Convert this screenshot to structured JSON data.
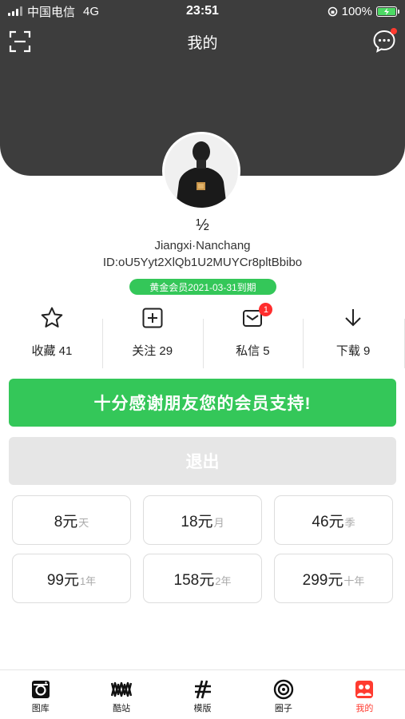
{
  "status_bar": {
    "carrier": "中国电信",
    "network": "4G",
    "time": "23:51",
    "battery": "100%"
  },
  "nav": {
    "title": "我的",
    "left_icon": "scan-icon",
    "right_icon": "message-icon"
  },
  "profile": {
    "username": "½",
    "location": "Jiangxi·Nanchang",
    "user_id": "ID:oU5Yyt2XlQb1U2MUYCr8pltBbibo",
    "vip_status": "黄金会员2021-03-31到期"
  },
  "stats": [
    {
      "icon": "star-icon",
      "label": "收藏 41"
    },
    {
      "icon": "plus-square-icon",
      "label": "关注 29"
    },
    {
      "icon": "envelope-icon",
      "label": "私信 5",
      "badge": "1"
    },
    {
      "icon": "download-arrow-icon",
      "label": "下载 9"
    }
  ],
  "buttons": {
    "thanks": "十分感谢朋友您的会员支持!",
    "logout": "退出"
  },
  "plans": [
    {
      "price": "8元",
      "period": "天"
    },
    {
      "price": "18元",
      "period": "月"
    },
    {
      "price": "46元",
      "period": "季"
    },
    {
      "price": "99元",
      "period": "1年"
    },
    {
      "price": "158元",
      "period": "2年"
    },
    {
      "price": "299元",
      "period": "十年"
    }
  ],
  "tabbar": [
    {
      "icon": "gallery-icon",
      "label": "图库"
    },
    {
      "icon": "cool-site-icon",
      "label": "酷站"
    },
    {
      "icon": "template-icon",
      "label": "模版"
    },
    {
      "icon": "circle-target-icon",
      "label": "圈子"
    },
    {
      "icon": "profile-icon",
      "label": "我的",
      "active": true
    }
  ],
  "colors": {
    "header_bg": "#3d3d3d",
    "accent_green": "#34c759",
    "badge_red": "#ff2d2d",
    "active_tab": "#ff3b30"
  }
}
